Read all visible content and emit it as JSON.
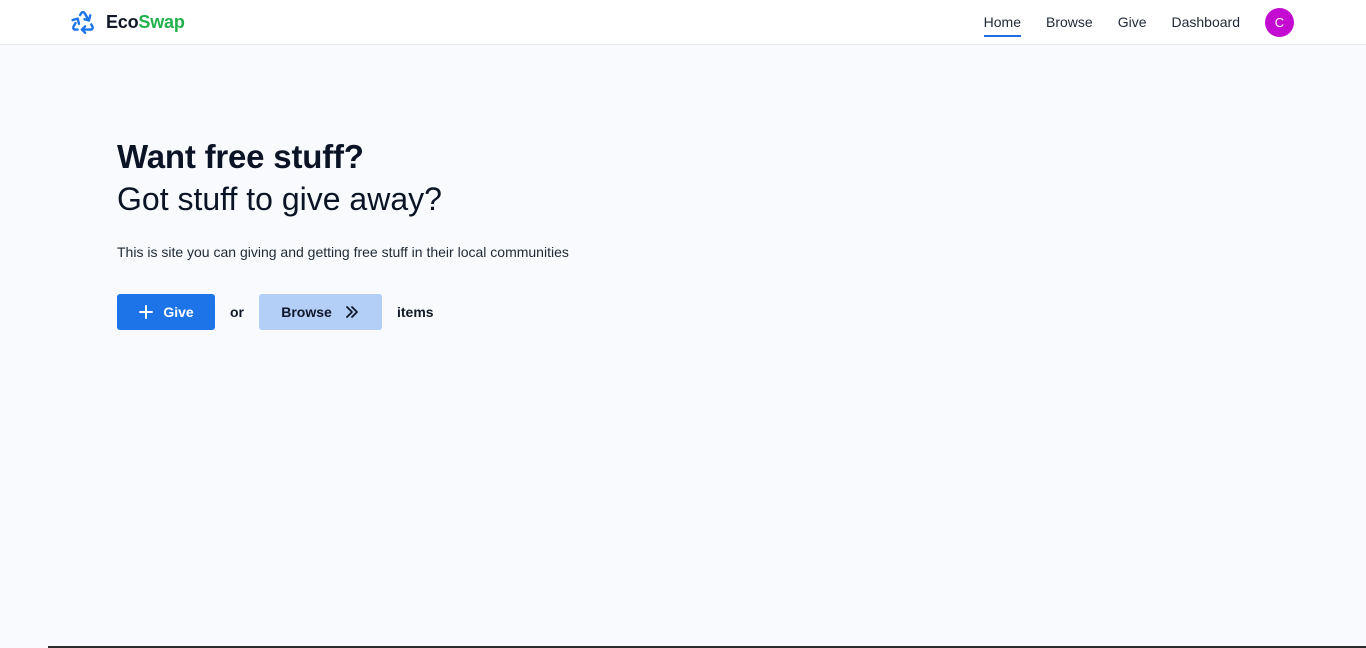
{
  "brand": {
    "name_part1": "Eco",
    "name_part2": "Swap",
    "icon": "recycle-icon"
  },
  "nav": {
    "home": "Home",
    "browse": "Browse",
    "give": "Give",
    "dashboard": "Dashboard",
    "active": "Home",
    "avatar_initial": "C"
  },
  "hero": {
    "title": "Want free stuff?",
    "subtitle": "Got stuff to give away?",
    "description": "This is site you can giving and getting free stuff in their local communities"
  },
  "actions": {
    "give_label": "Give",
    "give_icon": "plus-icon",
    "or_text": "or",
    "browse_label": "Browse",
    "browse_icon": "double-chevron-right-icon",
    "items_text": "items"
  },
  "colors": {
    "primary": "#1d73e8",
    "primary_light": "#b3cff7",
    "brand_green": "#22b14c",
    "avatar_bg": "#c30bd1",
    "page_bg": "#f8fafd"
  }
}
